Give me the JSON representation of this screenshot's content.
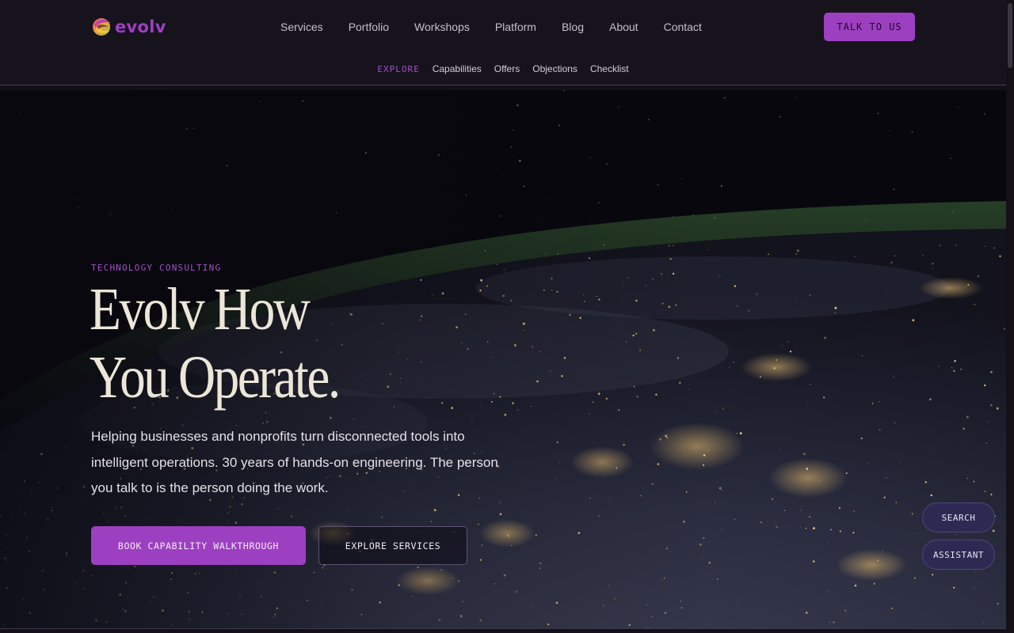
{
  "brand": {
    "name": "evolv"
  },
  "nav": {
    "items": [
      "Services",
      "Portfolio",
      "Workshops",
      "Platform",
      "Blog",
      "About",
      "Contact"
    ],
    "cta": "TALK TO US"
  },
  "subnav": {
    "label": "EXPLORE",
    "items": [
      "Capabilities",
      "Offers",
      "Objections",
      "Checklist"
    ]
  },
  "hero": {
    "eyebrow": "TECHNOLOGY CONSULTING",
    "headline_line1": "Evolv How",
    "headline_line2": "You Operate.",
    "description": "Helping businesses and nonprofits turn disconnected tools into intelligent operations. 30 years of hands-on engineering. The person you talk to is the person doing the work.",
    "primary_button": "BOOK CAPABILITY WALKTHROUGH",
    "secondary_button": "EXPLORE SERVICES"
  },
  "floating": {
    "search": "SEARCH",
    "assistant": "ASSISTANT"
  },
  "colors": {
    "accent": "#9d3fc1",
    "background": "#141019",
    "headline": "#ece6d8"
  },
  "icons": {
    "logo": "evolv-swirl-logo"
  }
}
